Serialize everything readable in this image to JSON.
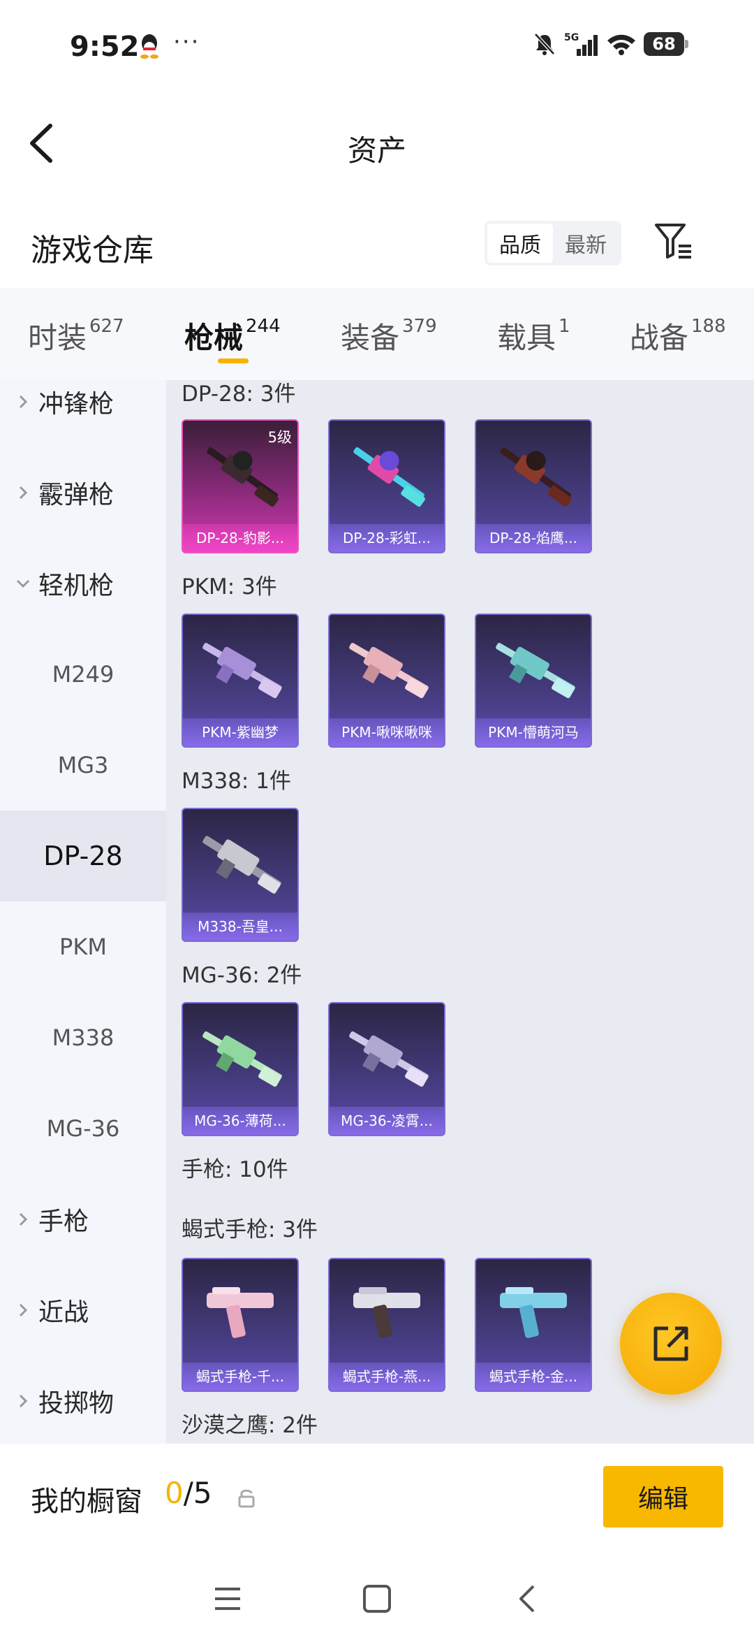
{
  "status_bar": {
    "time": "9:52",
    "dots": "···",
    "network": "5G",
    "battery": "68"
  },
  "header": {
    "title": "资产"
  },
  "warehouse": {
    "title": "游戏仓库",
    "sort_options": [
      "品质",
      "最新"
    ],
    "active_sort": "品质"
  },
  "tabs": [
    {
      "label": "时装",
      "count": "627"
    },
    {
      "label": "枪械",
      "count": "244"
    },
    {
      "label": "装备",
      "count": "379"
    },
    {
      "label": "载具",
      "count": "1"
    },
    {
      "label": "战备",
      "count": "188"
    }
  ],
  "active_tab": "枪械",
  "sidebar": {
    "items": [
      {
        "label": "冲锋枪",
        "type": "category",
        "expanded": false
      },
      {
        "label": "霰弹枪",
        "type": "category",
        "expanded": false
      },
      {
        "label": "轻机枪",
        "type": "category",
        "expanded": true
      },
      {
        "label": "M249",
        "type": "sub"
      },
      {
        "label": "MG3",
        "type": "sub"
      },
      {
        "label": "DP-28",
        "type": "sub",
        "active": true
      },
      {
        "label": "PKM",
        "type": "sub"
      },
      {
        "label": "M338",
        "type": "sub"
      },
      {
        "label": "MG-36",
        "type": "sub"
      },
      {
        "label": "手枪",
        "type": "category",
        "expanded": false
      },
      {
        "label": "近战",
        "type": "category",
        "expanded": false
      },
      {
        "label": "投掷物",
        "type": "category",
        "expanded": false
      }
    ]
  },
  "groups": [
    {
      "title": "DP-28: 3件",
      "items": [
        {
          "name": "DP-28-豹影...",
          "level": "5级",
          "style": "pink"
        },
        {
          "name": "DP-28-彩虹..."
        },
        {
          "name": "DP-28-焰鹰..."
        }
      ]
    },
    {
      "title": "PKM: 3件",
      "items": [
        {
          "name": "PKM-紫幽梦"
        },
        {
          "name": "PKM-啾咪啾咪"
        },
        {
          "name": "PKM-懵萌河马"
        }
      ]
    },
    {
      "title": "M338: 1件",
      "items": [
        {
          "name": "M338-吾皇..."
        }
      ]
    },
    {
      "title": "MG-36: 2件",
      "items": [
        {
          "name": "MG-36-薄荷..."
        },
        {
          "name": "MG-36-凌霄..."
        }
      ]
    },
    {
      "title": "手枪: 10件",
      "items": []
    },
    {
      "title": "蝎式手枪: 3件",
      "items": [
        {
          "name": "蝎式手枪-千..."
        },
        {
          "name": "蝎式手枪-燕..."
        },
        {
          "name": "蝎式手枪-金..."
        }
      ]
    },
    {
      "title": "沙漠之鹰: 2件",
      "items": []
    }
  ],
  "showcase": {
    "title": "我的橱窗",
    "current": "0",
    "max": "/5",
    "edit_label": "编辑"
  },
  "colors": {
    "accent": "#f5b300",
    "card_purple": "#433a7a",
    "card_pink": "#d33ab0"
  }
}
